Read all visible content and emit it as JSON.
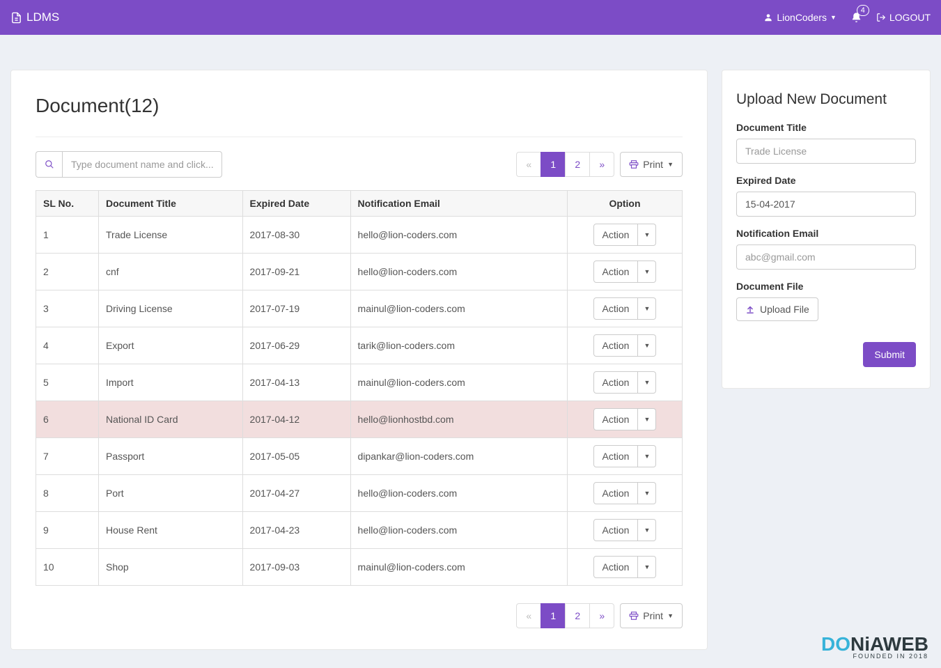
{
  "header": {
    "brand": "LDMS",
    "user": "LionCoders",
    "notif_count": "4",
    "logout": "LOGOUT"
  },
  "main": {
    "title": "Document(12)",
    "search_placeholder": "Type document name and click...",
    "print_label": "Print",
    "pagination": {
      "prev": "«",
      "p1": "1",
      "p2": "2",
      "next": "»"
    },
    "columns": {
      "sl": "SL No.",
      "title": "Document Title",
      "expired": "Expired Date",
      "email": "Notification Email",
      "option": "Option"
    },
    "action_label": "Action",
    "rows": [
      {
        "sl": "1",
        "title": "Trade License",
        "expired": "2017-08-30",
        "email": "hello@lion-coders.com",
        "highlight": false
      },
      {
        "sl": "2",
        "title": "cnf",
        "expired": "2017-09-21",
        "email": "hello@lion-coders.com",
        "highlight": false
      },
      {
        "sl": "3",
        "title": "Driving License",
        "expired": "2017-07-19",
        "email": "mainul@lion-coders.com",
        "highlight": false
      },
      {
        "sl": "4",
        "title": "Export",
        "expired": "2017-06-29",
        "email": "tarik@lion-coders.com",
        "highlight": false
      },
      {
        "sl": "5",
        "title": "Import",
        "expired": "2017-04-13",
        "email": "mainul@lion-coders.com",
        "highlight": false
      },
      {
        "sl": "6",
        "title": "National ID Card",
        "expired": "2017-04-12",
        "email": "hello@lionhostbd.com",
        "highlight": true
      },
      {
        "sl": "7",
        "title": "Passport",
        "expired": "2017-05-05",
        "email": "dipankar@lion-coders.com",
        "highlight": false
      },
      {
        "sl": "8",
        "title": "Port",
        "expired": "2017-04-27",
        "email": "hello@lion-coders.com",
        "highlight": false
      },
      {
        "sl": "9",
        "title": "House Rent",
        "expired": "2017-04-23",
        "email": "hello@lion-coders.com",
        "highlight": false
      },
      {
        "sl": "10",
        "title": "Shop",
        "expired": "2017-09-03",
        "email": "mainul@lion-coders.com",
        "highlight": false
      }
    ]
  },
  "form": {
    "title": "Upload New Document",
    "doc_title": {
      "label": "Document Title",
      "placeholder": "Trade License"
    },
    "expired": {
      "label": "Expired Date",
      "value": "15-04-2017"
    },
    "email": {
      "label": "Notification Email",
      "placeholder": "abc@gmail.com"
    },
    "file": {
      "label": "Document File",
      "button": "Upload File"
    },
    "submit": "Submit"
  },
  "watermark": {
    "main_pre": "D",
    "main_mid": "O",
    "main_post": "NiAWEB",
    "sub": "FOUNDED IN 2018"
  }
}
